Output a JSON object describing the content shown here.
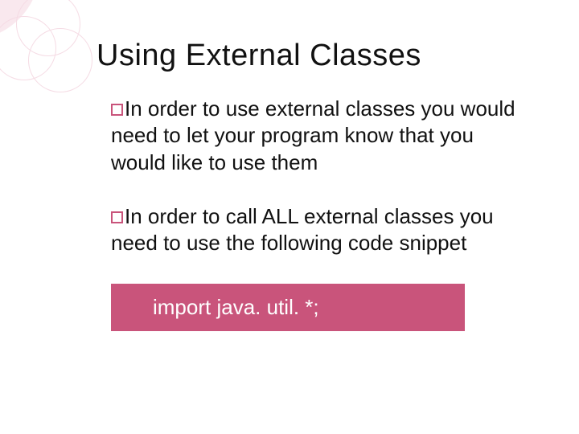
{
  "title": "Using External Classes",
  "bullets": [
    {
      "lead": "In",
      "rest": " order to use external classes you would need to let your program know that you would like to use them"
    },
    {
      "lead": "In",
      "rest": " order to call ALL external classes you need to use the following code snippet"
    }
  ],
  "code": "import java. util. *;"
}
